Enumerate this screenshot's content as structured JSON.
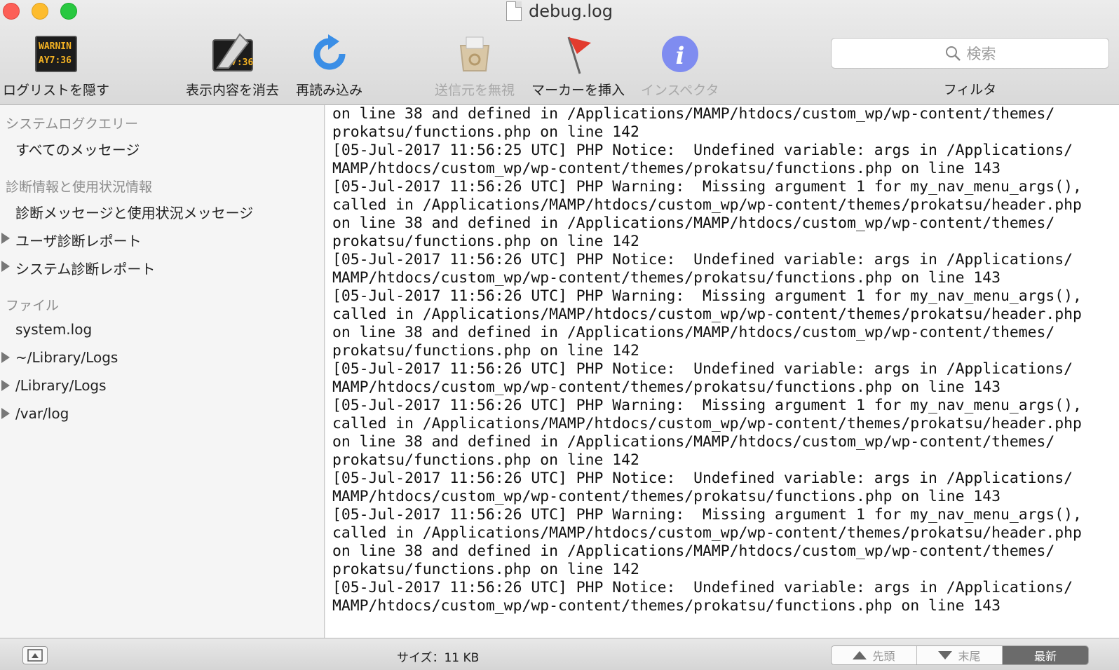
{
  "window": {
    "title": "debug.log"
  },
  "toolbar": {
    "hide_log_list": "ログリストを隠す",
    "led_line1": "WARNIN",
    "led_line2": "AY7:36",
    "clear_display": "表示内容を消去",
    "reload": "再読み込み",
    "ignore_sender": "送信元を無視",
    "insert_marker": "マーカーを挿入",
    "inspector": "インスペクタ",
    "search_placeholder": "検索",
    "filter": "フィルタ"
  },
  "sidebar": {
    "h_system_queries": "システムログクエリー",
    "all_messages": "すべてのメッセージ",
    "h_diagnostics": "診断情報と使用状況情報",
    "diag_messages": "診断メッセージと使用状況メッセージ",
    "user_reports": "ユーザ診断レポート",
    "system_reports": "システム診断レポート",
    "h_files": "ファイル",
    "system_log": "system.log",
    "user_library_logs": "~/Library/Logs",
    "library_logs": "/Library/Logs",
    "var_log": "/var/log"
  },
  "log_lines": [
    "on line 38 and defined in /Applications/MAMP/htdocs/custom_wp/wp-content/themes/",
    "prokatsu/functions.php on line 142",
    "[05-Jul-2017 11:56:25 UTC] PHP Notice:  Undefined variable: args in /Applications/",
    "MAMP/htdocs/custom_wp/wp-content/themes/prokatsu/functions.php on line 143",
    "[05-Jul-2017 11:56:26 UTC] PHP Warning:  Missing argument 1 for my_nav_menu_args(),",
    "called in /Applications/MAMP/htdocs/custom_wp/wp-content/themes/prokatsu/header.php",
    "on line 38 and defined in /Applications/MAMP/htdocs/custom_wp/wp-content/themes/",
    "prokatsu/functions.php on line 142",
    "[05-Jul-2017 11:56:26 UTC] PHP Notice:  Undefined variable: args in /Applications/",
    "MAMP/htdocs/custom_wp/wp-content/themes/prokatsu/functions.php on line 143",
    "[05-Jul-2017 11:56:26 UTC] PHP Warning:  Missing argument 1 for my_nav_menu_args(),",
    "called in /Applications/MAMP/htdocs/custom_wp/wp-content/themes/prokatsu/header.php",
    "on line 38 and defined in /Applications/MAMP/htdocs/custom_wp/wp-content/themes/",
    "prokatsu/functions.php on line 142",
    "[05-Jul-2017 11:56:26 UTC] PHP Notice:  Undefined variable: args in /Applications/",
    "MAMP/htdocs/custom_wp/wp-content/themes/prokatsu/functions.php on line 143",
    "[05-Jul-2017 11:56:26 UTC] PHP Warning:  Missing argument 1 for my_nav_menu_args(),",
    "called in /Applications/MAMP/htdocs/custom_wp/wp-content/themes/prokatsu/header.php",
    "on line 38 and defined in /Applications/MAMP/htdocs/custom_wp/wp-content/themes/",
    "prokatsu/functions.php on line 142",
    "[05-Jul-2017 11:56:26 UTC] PHP Notice:  Undefined variable: args in /Applications/",
    "MAMP/htdocs/custom_wp/wp-content/themes/prokatsu/functions.php on line 143",
    "[05-Jul-2017 11:56:26 UTC] PHP Warning:  Missing argument 1 for my_nav_menu_args(),",
    "called in /Applications/MAMP/htdocs/custom_wp/wp-content/themes/prokatsu/header.php",
    "on line 38 and defined in /Applications/MAMP/htdocs/custom_wp/wp-content/themes/",
    "prokatsu/functions.php on line 142",
    "[05-Jul-2017 11:56:26 UTC] PHP Notice:  Undefined variable: args in /Applications/",
    "MAMP/htdocs/custom_wp/wp-content/themes/prokatsu/functions.php on line 143"
  ],
  "statusbar": {
    "size": "サイズ：11 KB",
    "top": "先頭",
    "end": "末尾",
    "latest": "最新"
  },
  "colors": {
    "close": "#fc5f57",
    "minimize": "#fdbc2e",
    "maximize": "#28c840",
    "inspector_blue": "#6f7ff0",
    "reload_blue": "#3a8ee6",
    "marker_red": "#e23b2e"
  }
}
